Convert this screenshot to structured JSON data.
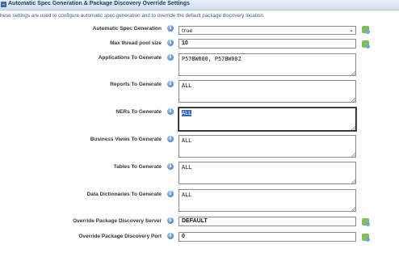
{
  "section": {
    "title": "Automatic Spec Generation & Package Discovery Override Settings",
    "collapse_glyph": "–",
    "description": "hese settings are used to configure automatic spec generation and to override the default package discovery location."
  },
  "info_glyph": "i",
  "fields": {
    "spec_generation": {
      "label": "Automatic Spec Generation",
      "value": "true",
      "arrow": "⌄"
    },
    "max_thread": {
      "label": "Max thread pool size",
      "value": "10"
    },
    "applications": {
      "label": "Applications To Generate",
      "value": "P57BW000, P57BW002"
    },
    "reports": {
      "label": "Reports To Generate",
      "value": "ALL"
    },
    "ners": {
      "label": "NERs To Generate",
      "value": "ALL"
    },
    "business_views": {
      "label": "Business Views To Generate",
      "value": "ALL"
    },
    "tables": {
      "label": "Tables To Generate",
      "value": "ALL"
    },
    "data_dictionaries": {
      "label": "Data Dictionaries To Generate",
      "value": "ALL"
    },
    "pkg_server": {
      "label": "Override Package Discovery Server",
      "value": "DEFAULT"
    },
    "pkg_port": {
      "label": "Override Package Discovery Port",
      "value": "0"
    }
  }
}
